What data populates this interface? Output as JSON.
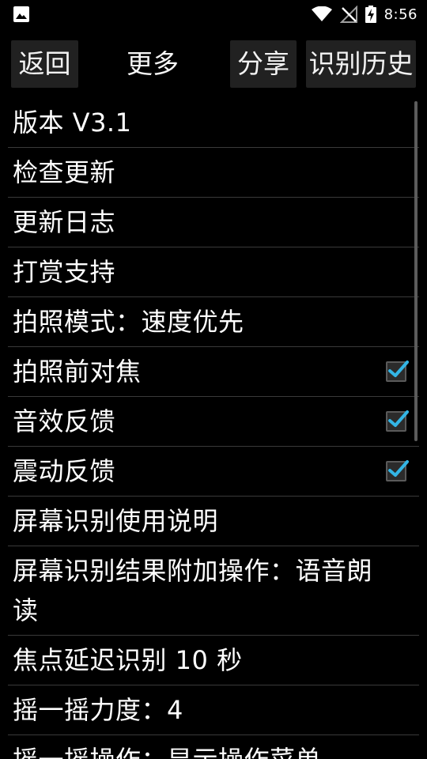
{
  "status_bar": {
    "time": "8:56"
  },
  "header": {
    "back_label": "返回",
    "title": "更多",
    "share_label": "分享",
    "history_label": "识别历史"
  },
  "menu": {
    "items": [
      {
        "label": "版本 V3.1"
      },
      {
        "label": "检查更新"
      },
      {
        "label": "更新日志"
      },
      {
        "label": "打赏支持"
      },
      {
        "label": "拍照模式：速度优先"
      },
      {
        "label": "拍照前对焦",
        "checked": true
      },
      {
        "label": "音效反馈",
        "checked": true
      },
      {
        "label": "震动反馈",
        "checked": true
      },
      {
        "label": "屏幕识别使用说明"
      },
      {
        "label": "屏幕识别结果附加操作：语音朗读"
      },
      {
        "label": "焦点延迟识别 10 秒"
      },
      {
        "label": "摇一摇力度：4"
      },
      {
        "label": "摇一摇操作：显示操作菜单"
      }
    ]
  },
  "colors": {
    "accent": "#33b5e5",
    "button_bg": "#212121",
    "divider": "#3a3a3a"
  }
}
